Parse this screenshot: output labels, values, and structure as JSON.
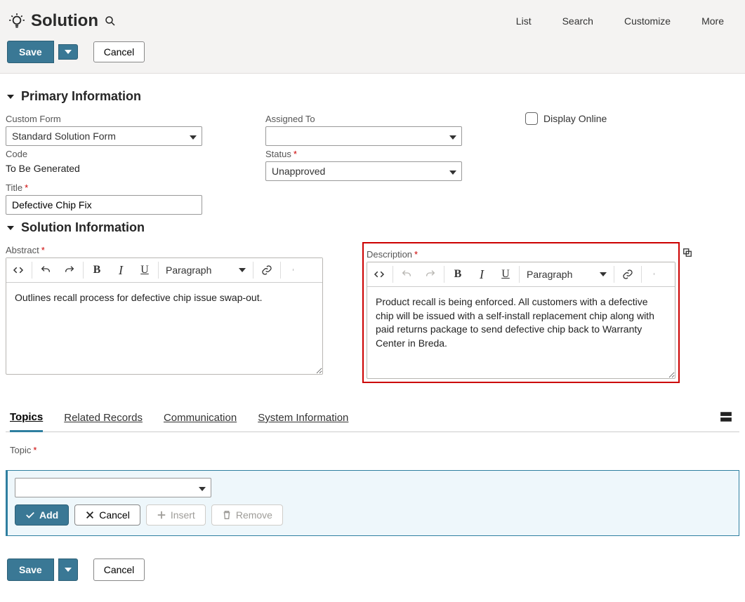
{
  "header": {
    "title": "Solution",
    "nav": {
      "list": "List",
      "search": "Search",
      "customize": "Customize",
      "more": "More"
    },
    "save_label": "Save",
    "cancel_label": "Cancel"
  },
  "primary": {
    "heading": "Primary Information",
    "custom_form_label": "Custom Form",
    "custom_form_value": "Standard Solution Form",
    "code_label": "Code",
    "code_value": "To Be Generated",
    "title_label": "Title",
    "title_value": "Defective Chip Fix",
    "assigned_to_label": "Assigned To",
    "assigned_to_value": "",
    "status_label": "Status",
    "status_value": "Unapproved",
    "display_online_label": "Display Online"
  },
  "solution": {
    "heading": "Solution Information",
    "abstract_label": "Abstract",
    "abstract_value": "Outlines recall process for defective chip issue swap-out.",
    "description_label": "Description",
    "description_value": "Product recall is being enforced. All customers with a defective chip will be issued with a self-install replacement chip along with paid returns package to send defective chip back to Warranty Center in Breda.",
    "format_label": "Paragraph"
  },
  "tabs": {
    "topics": "Topics",
    "related": "Related Records",
    "communication": "Communication",
    "system": "System Information"
  },
  "topics": {
    "topic_label": "Topic",
    "topic_value": "",
    "add_label": "Add",
    "cancel_label": "Cancel",
    "insert_label": "Insert",
    "remove_label": "Remove"
  },
  "footer": {
    "save_label": "Save",
    "cancel_label": "Cancel"
  }
}
